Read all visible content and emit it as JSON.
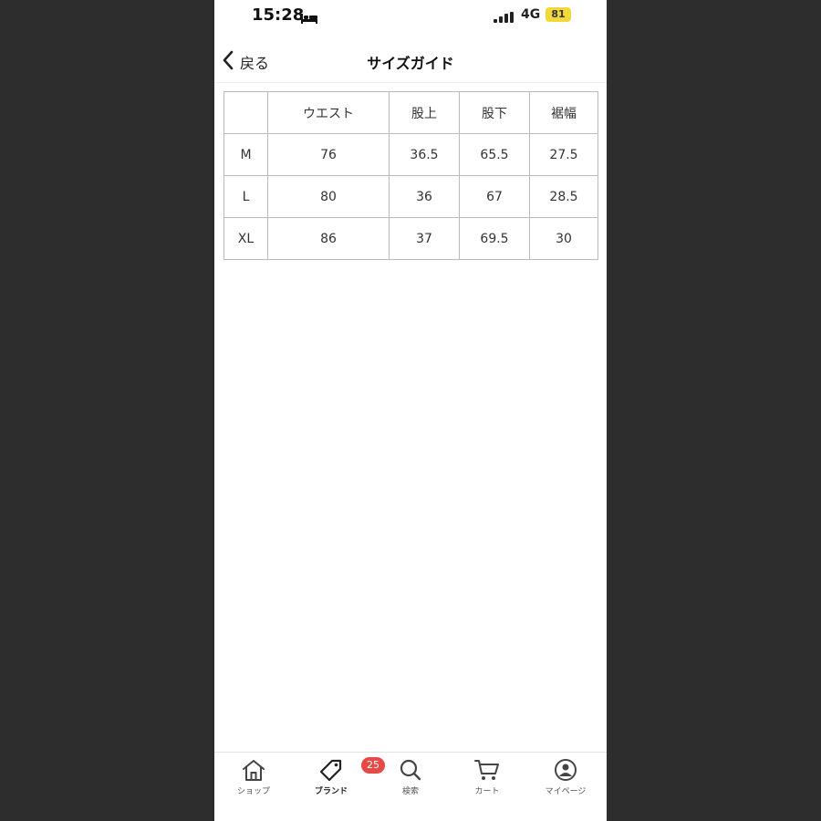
{
  "status_bar": {
    "time": "15:28",
    "network": "4G",
    "battery": "81",
    "focus_icon": "bed-icon",
    "signal_icon": "cellular-signal-icon"
  },
  "header": {
    "back_label": "戻る",
    "back_icon": "chevron-left-icon",
    "title": "サイズガイド"
  },
  "size_table": {
    "columns": [
      "",
      "ウエスト",
      "股上",
      "股下",
      "裾幅"
    ],
    "rows": [
      [
        "M",
        "76",
        "36.5",
        "65.5",
        "27.5"
      ],
      [
        "L",
        "80",
        "36",
        "67",
        "28.5"
      ],
      [
        "XL",
        "86",
        "37",
        "69.5",
        "30"
      ]
    ]
  },
  "tab_bar": {
    "tabs": [
      {
        "label": "ショップ",
        "icon": "home-icon"
      },
      {
        "label": "ブランド",
        "icon": "tag-icon",
        "active": true
      },
      {
        "label": "検索",
        "icon": "search-icon"
      },
      {
        "label": "カート",
        "icon": "cart-icon"
      },
      {
        "label": "マイページ",
        "icon": "user-icon"
      }
    ],
    "mypage_badge": "25"
  },
  "colors": {
    "background": "#2d2d2d",
    "badge": "#e64a45",
    "battery": "#f2d83a"
  }
}
